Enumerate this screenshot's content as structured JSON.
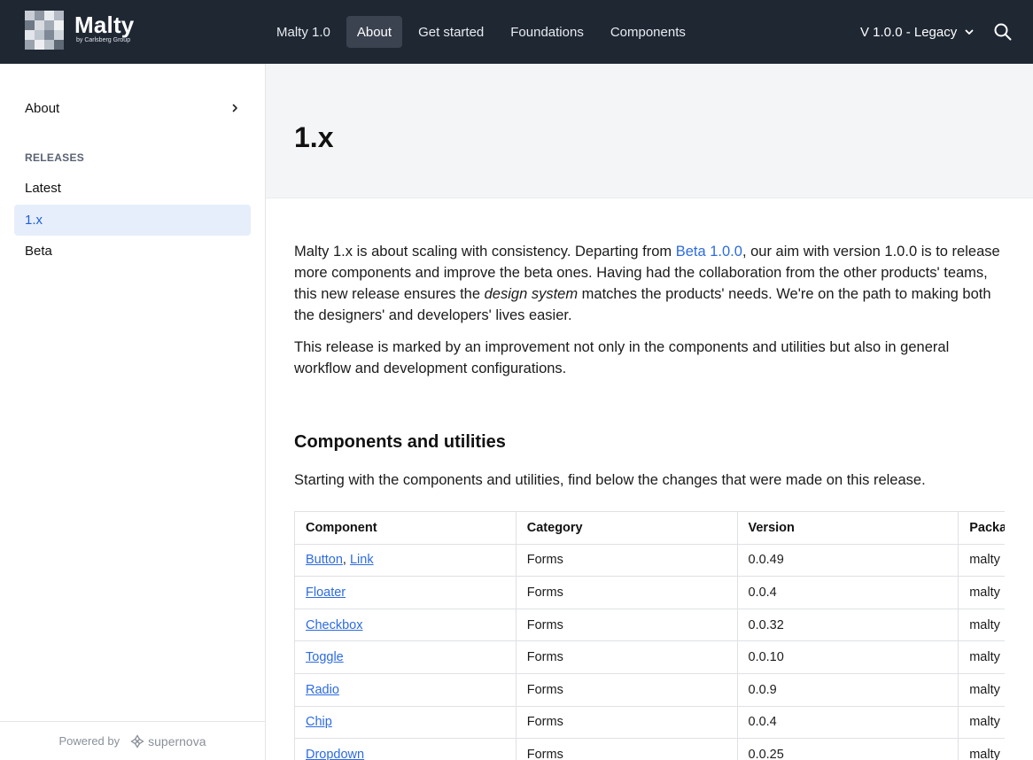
{
  "brand": {
    "name": "Malty",
    "subtitle": "by Carlsberg Group"
  },
  "nav": {
    "items": [
      "Malty 1.0",
      "About",
      "Get started",
      "Foundations",
      "Components"
    ],
    "active_index": 1
  },
  "version_select": {
    "label": "V 1.0.0 - Legacy"
  },
  "sidebar": {
    "about_label": "About",
    "section_heading": "RELEASES",
    "items": [
      "Latest",
      "1.x",
      "Beta"
    ],
    "active_index": 1,
    "powered_by": "Powered by",
    "powered_brand": "supernova"
  },
  "page": {
    "title": "1.x",
    "para1": {
      "before_link": "Malty 1.x is about scaling with consistency. Departing from ",
      "link": "Beta 1.0.0",
      "middle": ", our aim with version 1.0.0 is to release more components and improve the beta ones. Having had the collaboration from the other products' teams, this new release ensures the ",
      "emphasis": "design system",
      "after": " matches the products' needs. We're on the path to making both the designers' and developers' lives easier."
    },
    "para2": "This release is marked by an improvement not only in the components and utilities but also in general workflow and development configurations.",
    "section_title": "Components and utilities",
    "section_intro": "Starting with the components and utilities, find below the changes that were made on this release."
  },
  "table": {
    "headers": [
      "Component",
      "Category",
      "Version",
      "Package"
    ],
    "rows": [
      {
        "components": [
          "Button",
          "Link"
        ],
        "category": "Forms",
        "version": "0.0.49",
        "package": "malty"
      },
      {
        "components": [
          "Floater"
        ],
        "category": "Forms",
        "version": "0.0.4",
        "package": "malty"
      },
      {
        "components": [
          "Checkbox"
        ],
        "category": "Forms",
        "version": "0.0.32",
        "package": "malty"
      },
      {
        "components": [
          "Toggle"
        ],
        "category": "Forms",
        "version": "0.0.10",
        "package": "malty"
      },
      {
        "components": [
          "Radio"
        ],
        "category": "Forms",
        "version": "0.0.9",
        "package": "malty"
      },
      {
        "components": [
          "Chip"
        ],
        "category": "Forms",
        "version": "0.0.4",
        "package": "malty"
      },
      {
        "components": [
          "Dropdown"
        ],
        "category": "Forms",
        "version": "0.0.25",
        "package": "malty"
      }
    ]
  },
  "icons": {
    "search": "search-icon",
    "version_chevron": "chevron-down-icon",
    "about_chevron": "chevron-right-icon",
    "powered_logo": "supernova-logo-icon"
  },
  "colors": {
    "topbar": "#1f2733",
    "nav_active": "#3b4250",
    "link": "#2d6be0",
    "sidebar_active_bg": "#e6eefb",
    "sidebar_active_text": "#1f5fd6",
    "hero_bg": "#f4f5f6"
  }
}
